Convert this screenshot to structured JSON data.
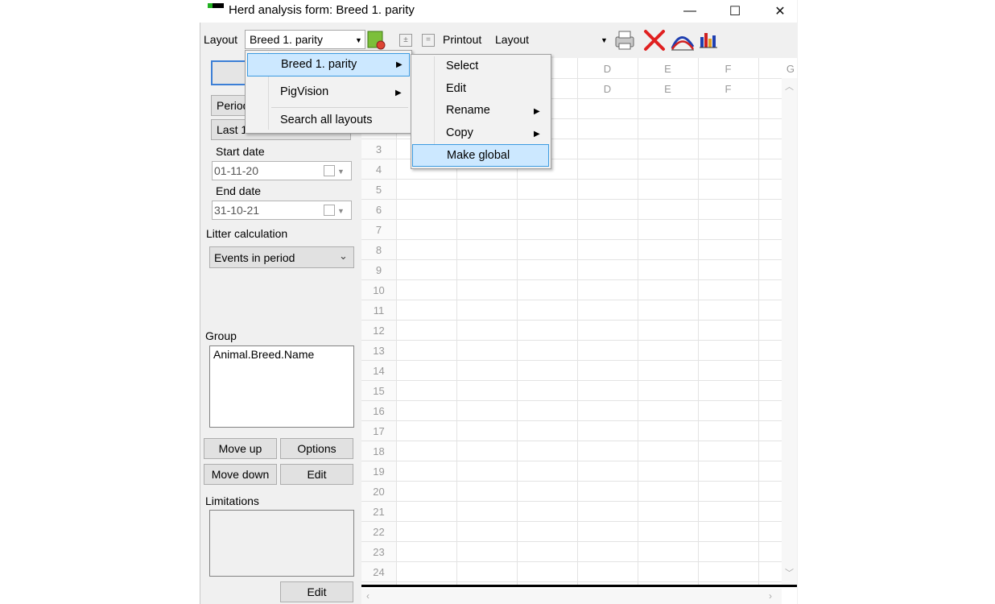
{
  "window": {
    "title": "Herd analysis form: Breed 1. parity",
    "minimize": "—",
    "maximize": "☐",
    "close": "✕"
  },
  "toolbar": {
    "layout_label": "Layout",
    "layout_value": "Breed 1. parity",
    "printout_label": "Printout",
    "printout_value": "Layout"
  },
  "left": {
    "period_button": "Period",
    "last_value": "Last 1",
    "start_date_label": "Start date",
    "start_date": "01-11-20",
    "end_date_label": "End date",
    "end_date": "31-10-21",
    "litter_label": "Litter calculation",
    "litter_value": "Events in period",
    "group_label": "Group",
    "group_item": "Animal.Breed.Name",
    "move_up": "Move up",
    "options": "Options",
    "move_down": "Move down",
    "edit": "Edit",
    "limitations_label": "Limitations",
    "edit2": "Edit"
  },
  "grid": {
    "columns": [
      "D",
      "E",
      "F",
      "G"
    ],
    "rows": [
      "3",
      "4",
      "5",
      "6",
      "7",
      "8",
      "9",
      "10",
      "11",
      "12",
      "13",
      "14",
      "15",
      "16",
      "17",
      "18",
      "19",
      "20",
      "21",
      "22",
      "23",
      "24"
    ]
  },
  "menu1": {
    "items": [
      "Breed 1. parity",
      "PigVision",
      "Search all layouts"
    ]
  },
  "menu2": {
    "items": [
      "Select",
      "Edit",
      "Rename",
      "Copy",
      "Make global"
    ]
  }
}
